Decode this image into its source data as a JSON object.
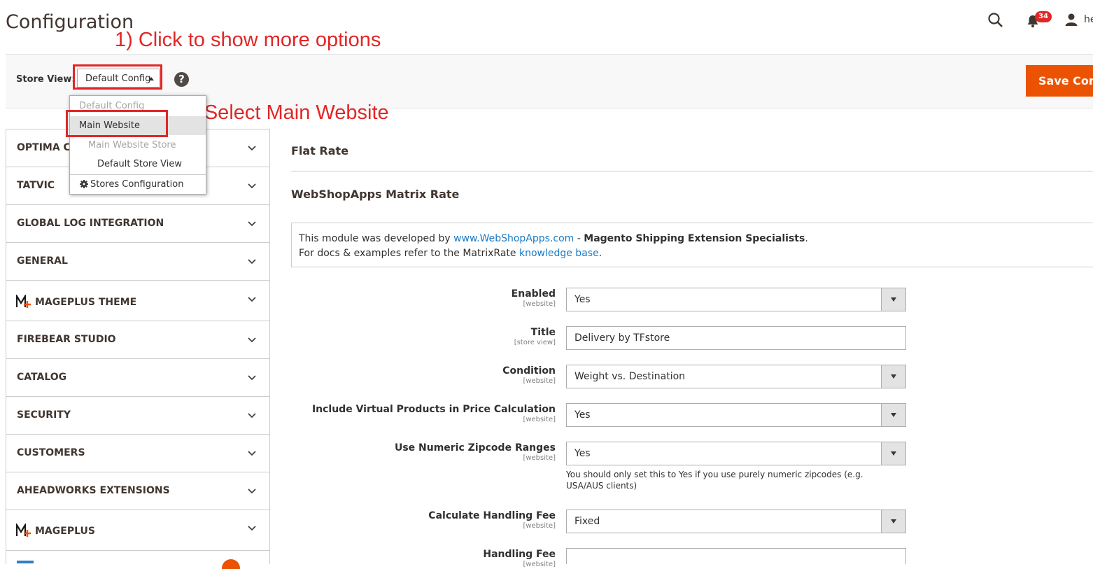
{
  "header": {
    "title": "Configuration",
    "notification_count": "34",
    "user_name_partial": "he"
  },
  "annotations": {
    "step1": "1) Click to show more options",
    "step2": "2) Select Main Website"
  },
  "toolbar": {
    "store_view_label": "Store View:",
    "store_view_value": "Default Config",
    "help_symbol": "?",
    "save_label": "Save Conf"
  },
  "store_dropdown": {
    "items": [
      {
        "label": "Default Config"
      },
      {
        "label": "Main Website"
      },
      {
        "label": "Main Website Store"
      },
      {
        "label": "Default Store View"
      }
    ],
    "stores_configuration": "Stores Configuration"
  },
  "sidebar": {
    "items": [
      {
        "label": "OPTIMA CO"
      },
      {
        "label": "TATVIC"
      },
      {
        "label": "GLOBAL LOG INTEGRATION"
      },
      {
        "label": "GENERAL"
      },
      {
        "label": "MAGEPLUS THEME"
      },
      {
        "label": "FIREBEAR STUDIO"
      },
      {
        "label": "CATALOG"
      },
      {
        "label": "SECURITY"
      },
      {
        "label": "CUSTOMERS"
      },
      {
        "label": "AHEADWORKS EXTENSIONS"
      },
      {
        "label": "MAGEPLUS"
      }
    ]
  },
  "main": {
    "section1": "Flat Rate",
    "section2": "WebShopApps Matrix Rate",
    "note": {
      "l1_prefix": "This module was developed by ",
      "l1_link": "www.WebShopApps.com",
      "l1_sep": " - ",
      "l1_bold": "Magento Shipping Extension Specialists",
      "l1_end": ".",
      "l2_prefix": "For docs & examples refer to the MatrixRate ",
      "l2_link": "knowledge base",
      "l2_end": "."
    },
    "fields": [
      {
        "label": "Enabled",
        "scope": "[website]",
        "value": "Yes"
      },
      {
        "label": "Title",
        "scope": "[store view]",
        "value": "Delivery by TFstore"
      },
      {
        "label": "Condition",
        "scope": "[website]",
        "value": "Weight vs. Destination"
      },
      {
        "label": "Include Virtual Products in Price Calculation",
        "scope": "[website]",
        "value": "Yes"
      },
      {
        "label": "Use Numeric Zipcode Ranges",
        "scope": "[website]",
        "value": "Yes",
        "note": "You should only set this to Yes if you use purely numeric zipcodes (e.g. USA/AUS clients)"
      },
      {
        "label": "Calculate Handling Fee",
        "scope": "[website]",
        "value": "Fixed"
      },
      {
        "label": "Handling Fee",
        "scope": "[website]",
        "value": ""
      }
    ]
  },
  "colors": {
    "accent": "#eb5202",
    "annotation_red": "#e22626",
    "link": "#1979c3"
  }
}
